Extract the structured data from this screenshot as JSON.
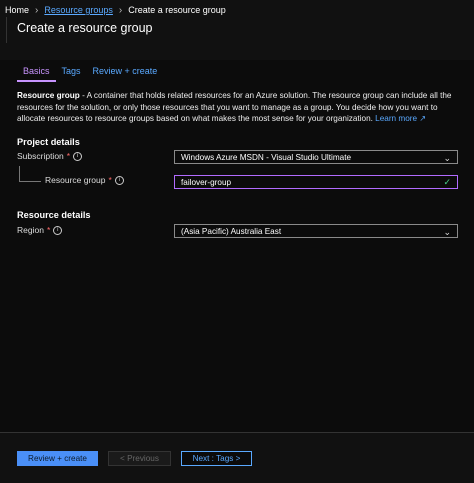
{
  "breadcrumb": {
    "home": "Home",
    "resource_groups": "Resource groups",
    "current": "Create a resource group"
  },
  "page": {
    "title": "Create a resource group"
  },
  "tabs": [
    {
      "label": "Basics",
      "active": true
    },
    {
      "label": "Tags",
      "active": false
    },
    {
      "label": "Review + create",
      "active": false
    }
  ],
  "description": {
    "bold": "Resource group",
    "text": " - A container that holds related resources for an Azure solution. The resource group can include all the resources for the solution, or only those resources that you want to manage as a group. You decide how you want to allocate resources to resource groups based on what makes the most sense for your organization. ",
    "learn_more": "Learn more"
  },
  "project_details": {
    "heading": "Project details",
    "subscription": {
      "label": "Subscription",
      "value": "Windows Azure MSDN - Visual Studio Ultimate"
    },
    "resource_group": {
      "label": "Resource group",
      "value": "failover-group"
    }
  },
  "resource_details": {
    "heading": "Resource details",
    "region": {
      "label": "Region",
      "value": "(Asia Pacific) Australia East"
    }
  },
  "footer": {
    "review_create": "Review + create",
    "previous": "< Previous",
    "next": "Next : Tags >"
  },
  "colors": {
    "accent": "#5aa9ff",
    "active_tab": "#c894ff",
    "primary_button": "#4a8ff7",
    "valid": "#47d18a",
    "required": "#ff6b6b"
  },
  "icons": [
    "chevron-right-icon",
    "info-icon",
    "chevron-down-icon",
    "checkmark-icon",
    "external-link-icon"
  ]
}
